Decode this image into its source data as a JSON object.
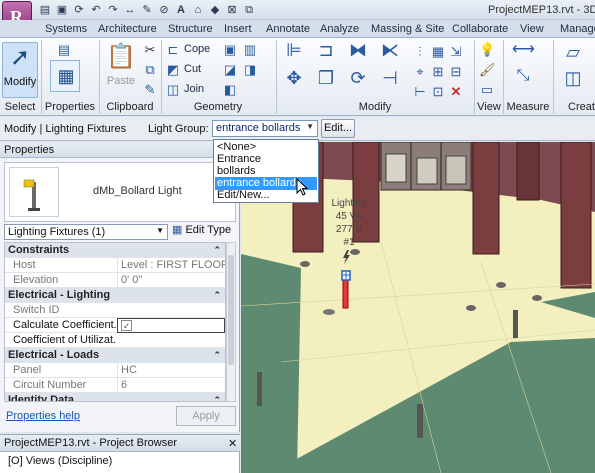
{
  "window": {
    "app_button_label": "R",
    "document_title": "ProjectMEP13.rvt - 3D Vi"
  },
  "quick_access": [
    "open-icon",
    "save-icon",
    "sync-icon",
    "undo-icon",
    "redo-icon",
    "measure-icon",
    "tag-icon",
    "text-icon",
    "3d-view-icon",
    "section-icon",
    "close-hidden-icon",
    "switch-windows-icon"
  ],
  "tabs": [
    {
      "label": "Systems"
    },
    {
      "label": "Architecture"
    },
    {
      "label": "Structure"
    },
    {
      "label": "Insert"
    },
    {
      "label": "Annotate"
    },
    {
      "label": "Analyze"
    },
    {
      "label": "Massing & Site"
    },
    {
      "label": "Collaborate"
    },
    {
      "label": "View"
    },
    {
      "label": "Manage"
    }
  ],
  "ribbon": {
    "modify_label": "Modify",
    "paste_label": "Paste",
    "cope_label": "Cope",
    "cut_label": "Cut",
    "join_label": "Join",
    "panels": {
      "select": "Select",
      "properties": "Properties",
      "clipboard": "Clipboard",
      "geometry": "Geometry",
      "modify": "Modify",
      "view": "View",
      "measure": "Measure",
      "create": "Creat"
    }
  },
  "options_bar": {
    "context": "Modify | Lighting Fixtures",
    "light_group_label": "Light Group:",
    "light_group_value": "entrance bollards",
    "edit_label": "Edit..."
  },
  "dropdown": {
    "options": [
      "<None>",
      "Entrance",
      "bollards",
      "entrance bollards",
      "Edit/New..."
    ],
    "selected": "entrance bollards"
  },
  "properties": {
    "title": "Properties",
    "type_name": "dMb_Bollard Light",
    "filter": "Lighting Fixtures (1)",
    "edit_type": "Edit Type",
    "groups": {
      "constraints": "Constraints",
      "electrical_lighting": "Electrical - Lighting",
      "electrical_loads": "Electrical - Loads",
      "identity": "Identity Data"
    },
    "rows": {
      "host_k": "Host",
      "host_v": "Level : FIRST FLOOR",
      "elev_k": "Elevation",
      "elev_v": "0' 0\"",
      "switch_k": "Switch ID",
      "switch_v": "",
      "calc_k": "Calculate Coefficient...",
      "coef_k": "Coefficient of Utilizat...",
      "panel_k": "Panel",
      "panel_v": "HC",
      "circuit_k": "Circuit Number",
      "circuit_v": "6"
    },
    "help_link": "Properties help",
    "apply": "Apply"
  },
  "project_browser": {
    "title": "ProjectMEP13.rvt - Project Browser",
    "item": "[O] Views (Discipline)"
  },
  "tag": {
    "line1": "Lighting",
    "line2": "45 VA",
    "line3": "277 V",
    "line4": "#1"
  },
  "colors": {
    "floor": "#f3efbf",
    "grass": "#5d8a70",
    "brick": "#7d4a52",
    "column": "#7a3e40",
    "selection": "#3399ff"
  }
}
